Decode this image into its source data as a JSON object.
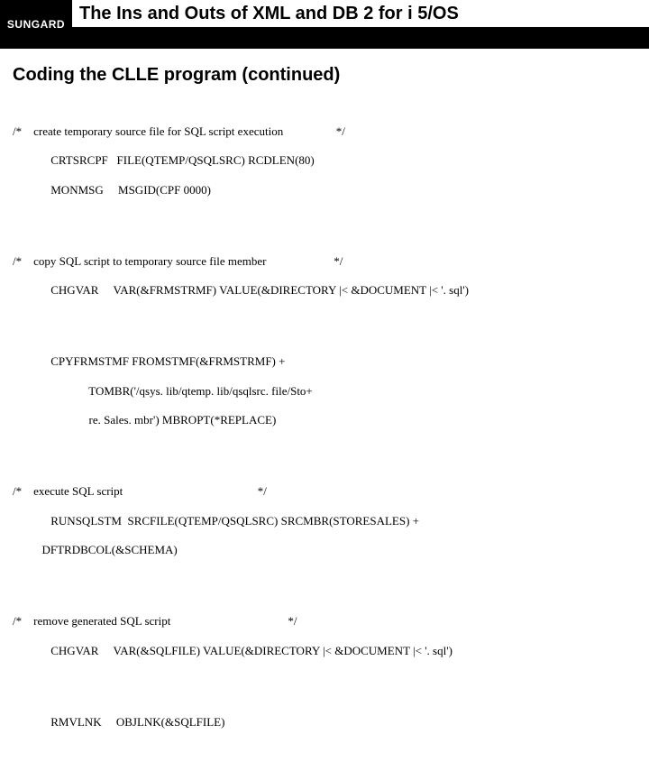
{
  "brand": "SUNGARD",
  "title": "The Ins and Outs of XML and DB 2 for i 5/OS",
  "subtitle": "Coding the CLLE program (continued)",
  "blocks": {
    "b1l1": "/*    create temporary source file for SQL script execution                  */",
    "b1l2": "             CRTSRCPF   FILE(QTEMP/QSQLSRC) RCDLEN(80)",
    "b1l3": "             MONMSG     MSGID(CPF 0000)",
    "b2l1": "/*    copy SQL script to temporary source file member                       */",
    "b2l2": "             CHGVAR     VAR(&FRMSTRMF) VALUE(&DIRECTORY |< &DOCUMENT |< '. sql')",
    "b3l1": "             CPYFRMSTMF FROMSTMF(&FRMSTRMF) +",
    "b3l2": "                          TOMBR('/qsys. lib/qtemp. lib/qsqlsrc. file/Sto+",
    "b3l3": "                          re. Sales. mbr') MBROPT(*REPLACE)",
    "b4l1": "/*    execute SQL script                                              */",
    "b4l2": "             RUNSQLSTM  SRCFILE(QTEMP/QSQLSRC) SRCMBR(STORESALES) +",
    "b4l3": "          DFTRDBCOL(&SCHEMA)",
    "b5l1": "/*    remove generated SQL script                                        */",
    "b5l2": "             CHGVAR     VAR(&SQLFILE) VALUE(&DIRECTORY |< &DOCUMENT |< '. sql')",
    "b6l1": "             RMVLNK     OBJLNK(&SQLFILE)"
  }
}
